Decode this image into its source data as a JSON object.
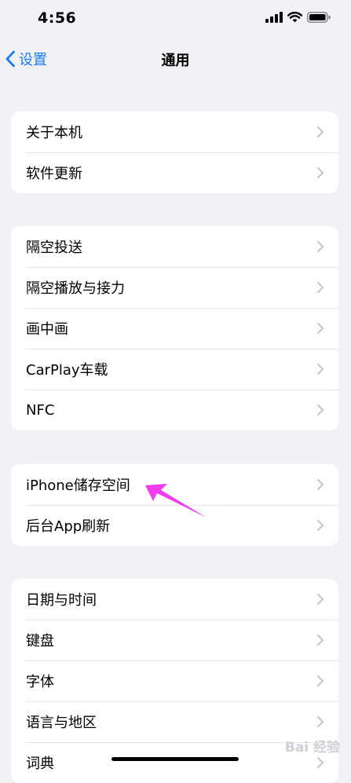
{
  "status_bar": {
    "time": "4:56",
    "icons": [
      "cellular-signal-icon",
      "wifi-icon",
      "battery-icon"
    ]
  },
  "nav": {
    "back_label": "设置",
    "title": "通用",
    "accent_color": "#1a7cf5"
  },
  "groups": [
    {
      "items": [
        "关于本机",
        "软件更新"
      ]
    },
    {
      "items": [
        "隔空投送",
        "隔空播放与接力",
        "画中画",
        "CarPlay车载",
        "NFC"
      ]
    },
    {
      "items": [
        "iPhone储存空间",
        "后台App刷新"
      ]
    },
    {
      "items": [
        "日期与时间",
        "键盘",
        "字体",
        "语言与地区",
        "词典"
      ]
    }
  ],
  "annotation": {
    "target": "iPhone储存空间",
    "color": "#f23cf0"
  },
  "watermark": "Bai 经验"
}
